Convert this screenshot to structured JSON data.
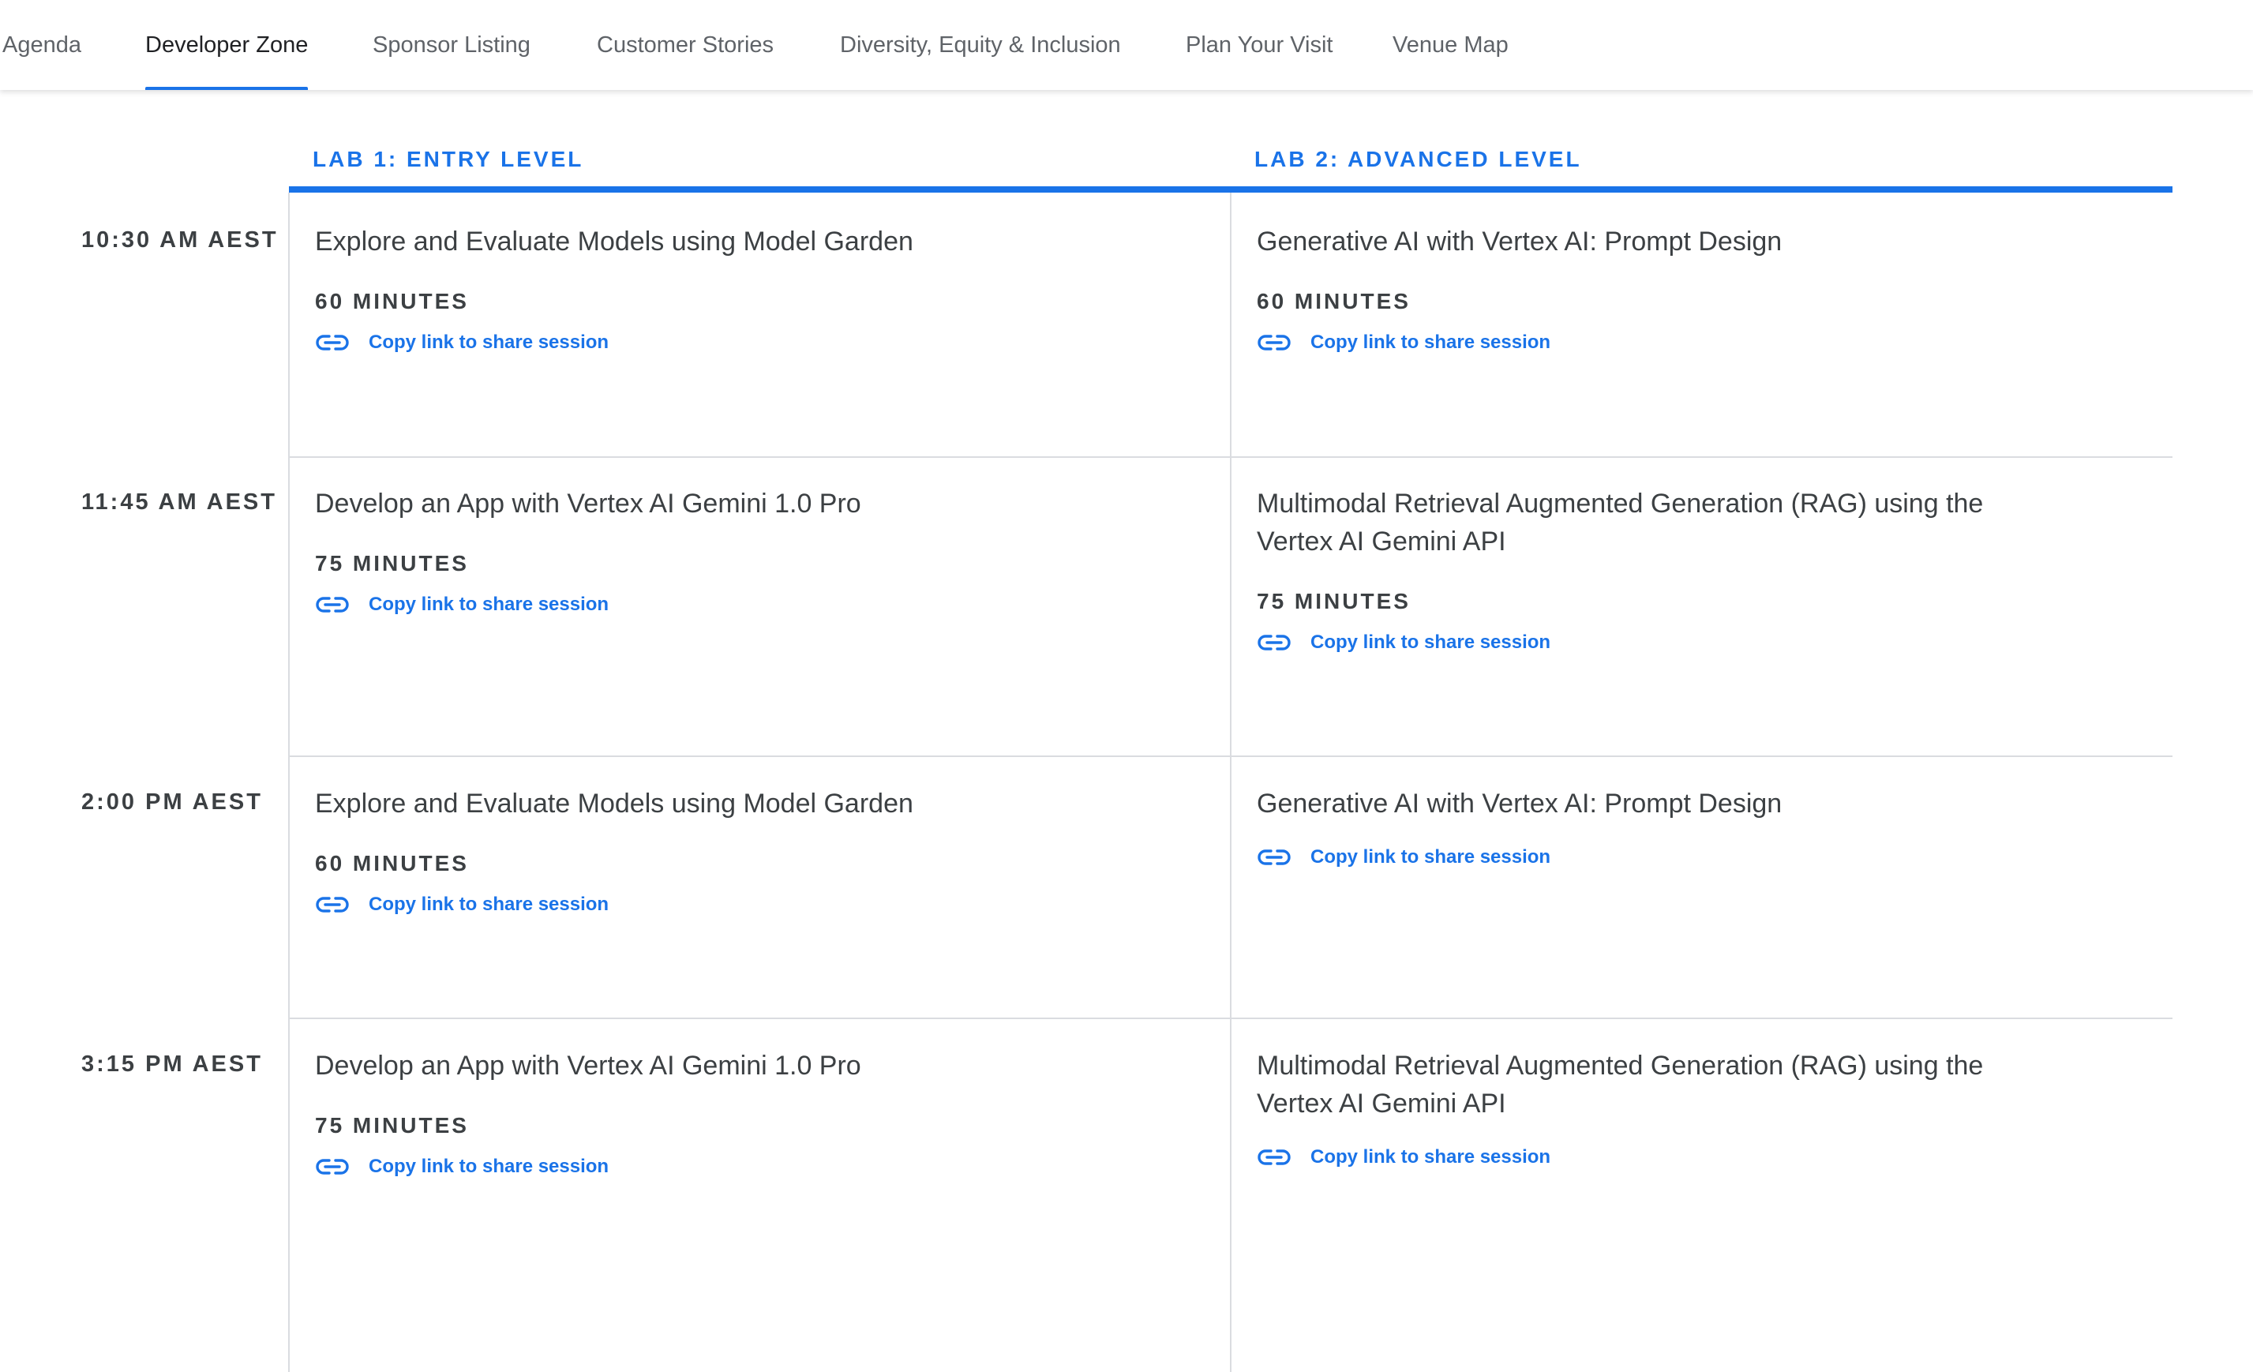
{
  "nav": {
    "tabs": [
      {
        "label": "Agenda",
        "active": false
      },
      {
        "label": "Developer Zone",
        "active": true
      },
      {
        "label": "Sponsor Listing",
        "active": false
      },
      {
        "label": "Customer Stories",
        "active": false
      },
      {
        "label": "Diversity, Equity & Inclusion",
        "active": false
      },
      {
        "label": "Plan Your Visit",
        "active": false
      },
      {
        "label": "Venue Map",
        "active": false
      }
    ]
  },
  "labs": [
    {
      "label": "LAB 1: ENTRY LEVEL"
    },
    {
      "label": "LAB 2: ADVANCED LEVEL"
    }
  ],
  "copy_link_label": "Copy link to share session",
  "colors": {
    "accent": "#1a73e8",
    "text": "#3c4043",
    "divider": "#dadce0"
  },
  "slots": [
    {
      "time": "10:30 AM AEST",
      "lab1": {
        "title": "Explore and Evaluate Models using Model Garden",
        "duration": "60 MINUTES"
      },
      "lab2": {
        "title": "Generative AI with Vertex AI: Prompt Design",
        "duration": "60 MINUTES"
      }
    },
    {
      "time": "11:45 AM AEST",
      "lab1": {
        "title": "Develop an App with Vertex AI Gemini 1.0 Pro",
        "duration": "75 MINUTES"
      },
      "lab2": {
        "title": "Multimodal Retrieval Augmented Generation (RAG) using the Vertex AI Gemini API",
        "duration": "75 MINUTES"
      }
    },
    {
      "time": "2:00 PM AEST",
      "lab1": {
        "title": "Explore and Evaluate Models using Model Garden",
        "duration": "60 MINUTES"
      },
      "lab2": {
        "title": "Generative AI with Vertex AI: Prompt Design"
      }
    },
    {
      "time": "3:15 PM AEST",
      "lab1": {
        "title": "Develop an App with Vertex AI Gemini 1.0 Pro",
        "duration": "75 MINUTES"
      },
      "lab2": {
        "title": "Multimodal Retrieval Augmented Generation (RAG) using the Vertex AI Gemini API"
      }
    }
  ]
}
